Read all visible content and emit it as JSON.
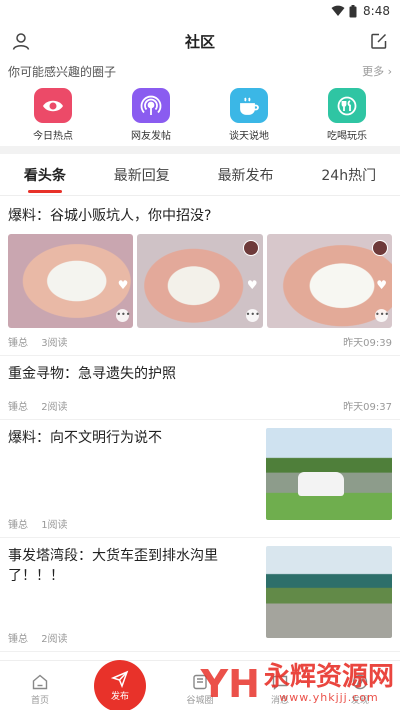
{
  "status_bar": {
    "time": "8:48"
  },
  "header": {
    "title": "社区"
  },
  "circles_section": {
    "heading": "你可能感兴趣的圈子",
    "more_label": "更多 ›",
    "items": [
      {
        "label": "今日热点",
        "icon": "eye-icon",
        "color": "#ec4a68"
      },
      {
        "label": "网友发帖",
        "icon": "broadcast-icon",
        "color": "#8a5cf0"
      },
      {
        "label": "谈天说地",
        "icon": "coffee-cup-icon",
        "color": "#3bb7e6"
      },
      {
        "label": "吃喝玩乐",
        "icon": "fork-spoon-icon",
        "color": "#2fc5a3"
      }
    ]
  },
  "tabs": [
    {
      "label": "看头条",
      "active": true
    },
    {
      "label": "最新回复",
      "active": false
    },
    {
      "label": "最新发布",
      "active": false
    },
    {
      "label": "24h热门",
      "active": false
    }
  ],
  "posts": [
    {
      "title": "爆料：谷城小贩坑人，你中招没?",
      "author": "锤总",
      "reads": "3阅读",
      "time": "昨天09:39"
    },
    {
      "title": "重金寻物：急寻遗失的护照",
      "author": "锤总",
      "reads": "2阅读",
      "time": "昨天09:37"
    },
    {
      "title": "爆料：向不文明行为说不",
      "author": "锤总",
      "reads": "1阅读",
      "time": ""
    },
    {
      "title": "事发塔湾段：大货车歪到排水沟里了！！！",
      "author": "锤总",
      "reads": "2阅读",
      "time": ""
    }
  ],
  "bottom_nav": {
    "home": "首页",
    "publish": "发布",
    "circle": "谷城圈",
    "message": "消息",
    "discover": "发现"
  },
  "watermark": {
    "logo": "YH",
    "name": "永辉资源网",
    "url": "www.yhkjjj.com"
  },
  "colors": {
    "accent": "#e8322a"
  }
}
